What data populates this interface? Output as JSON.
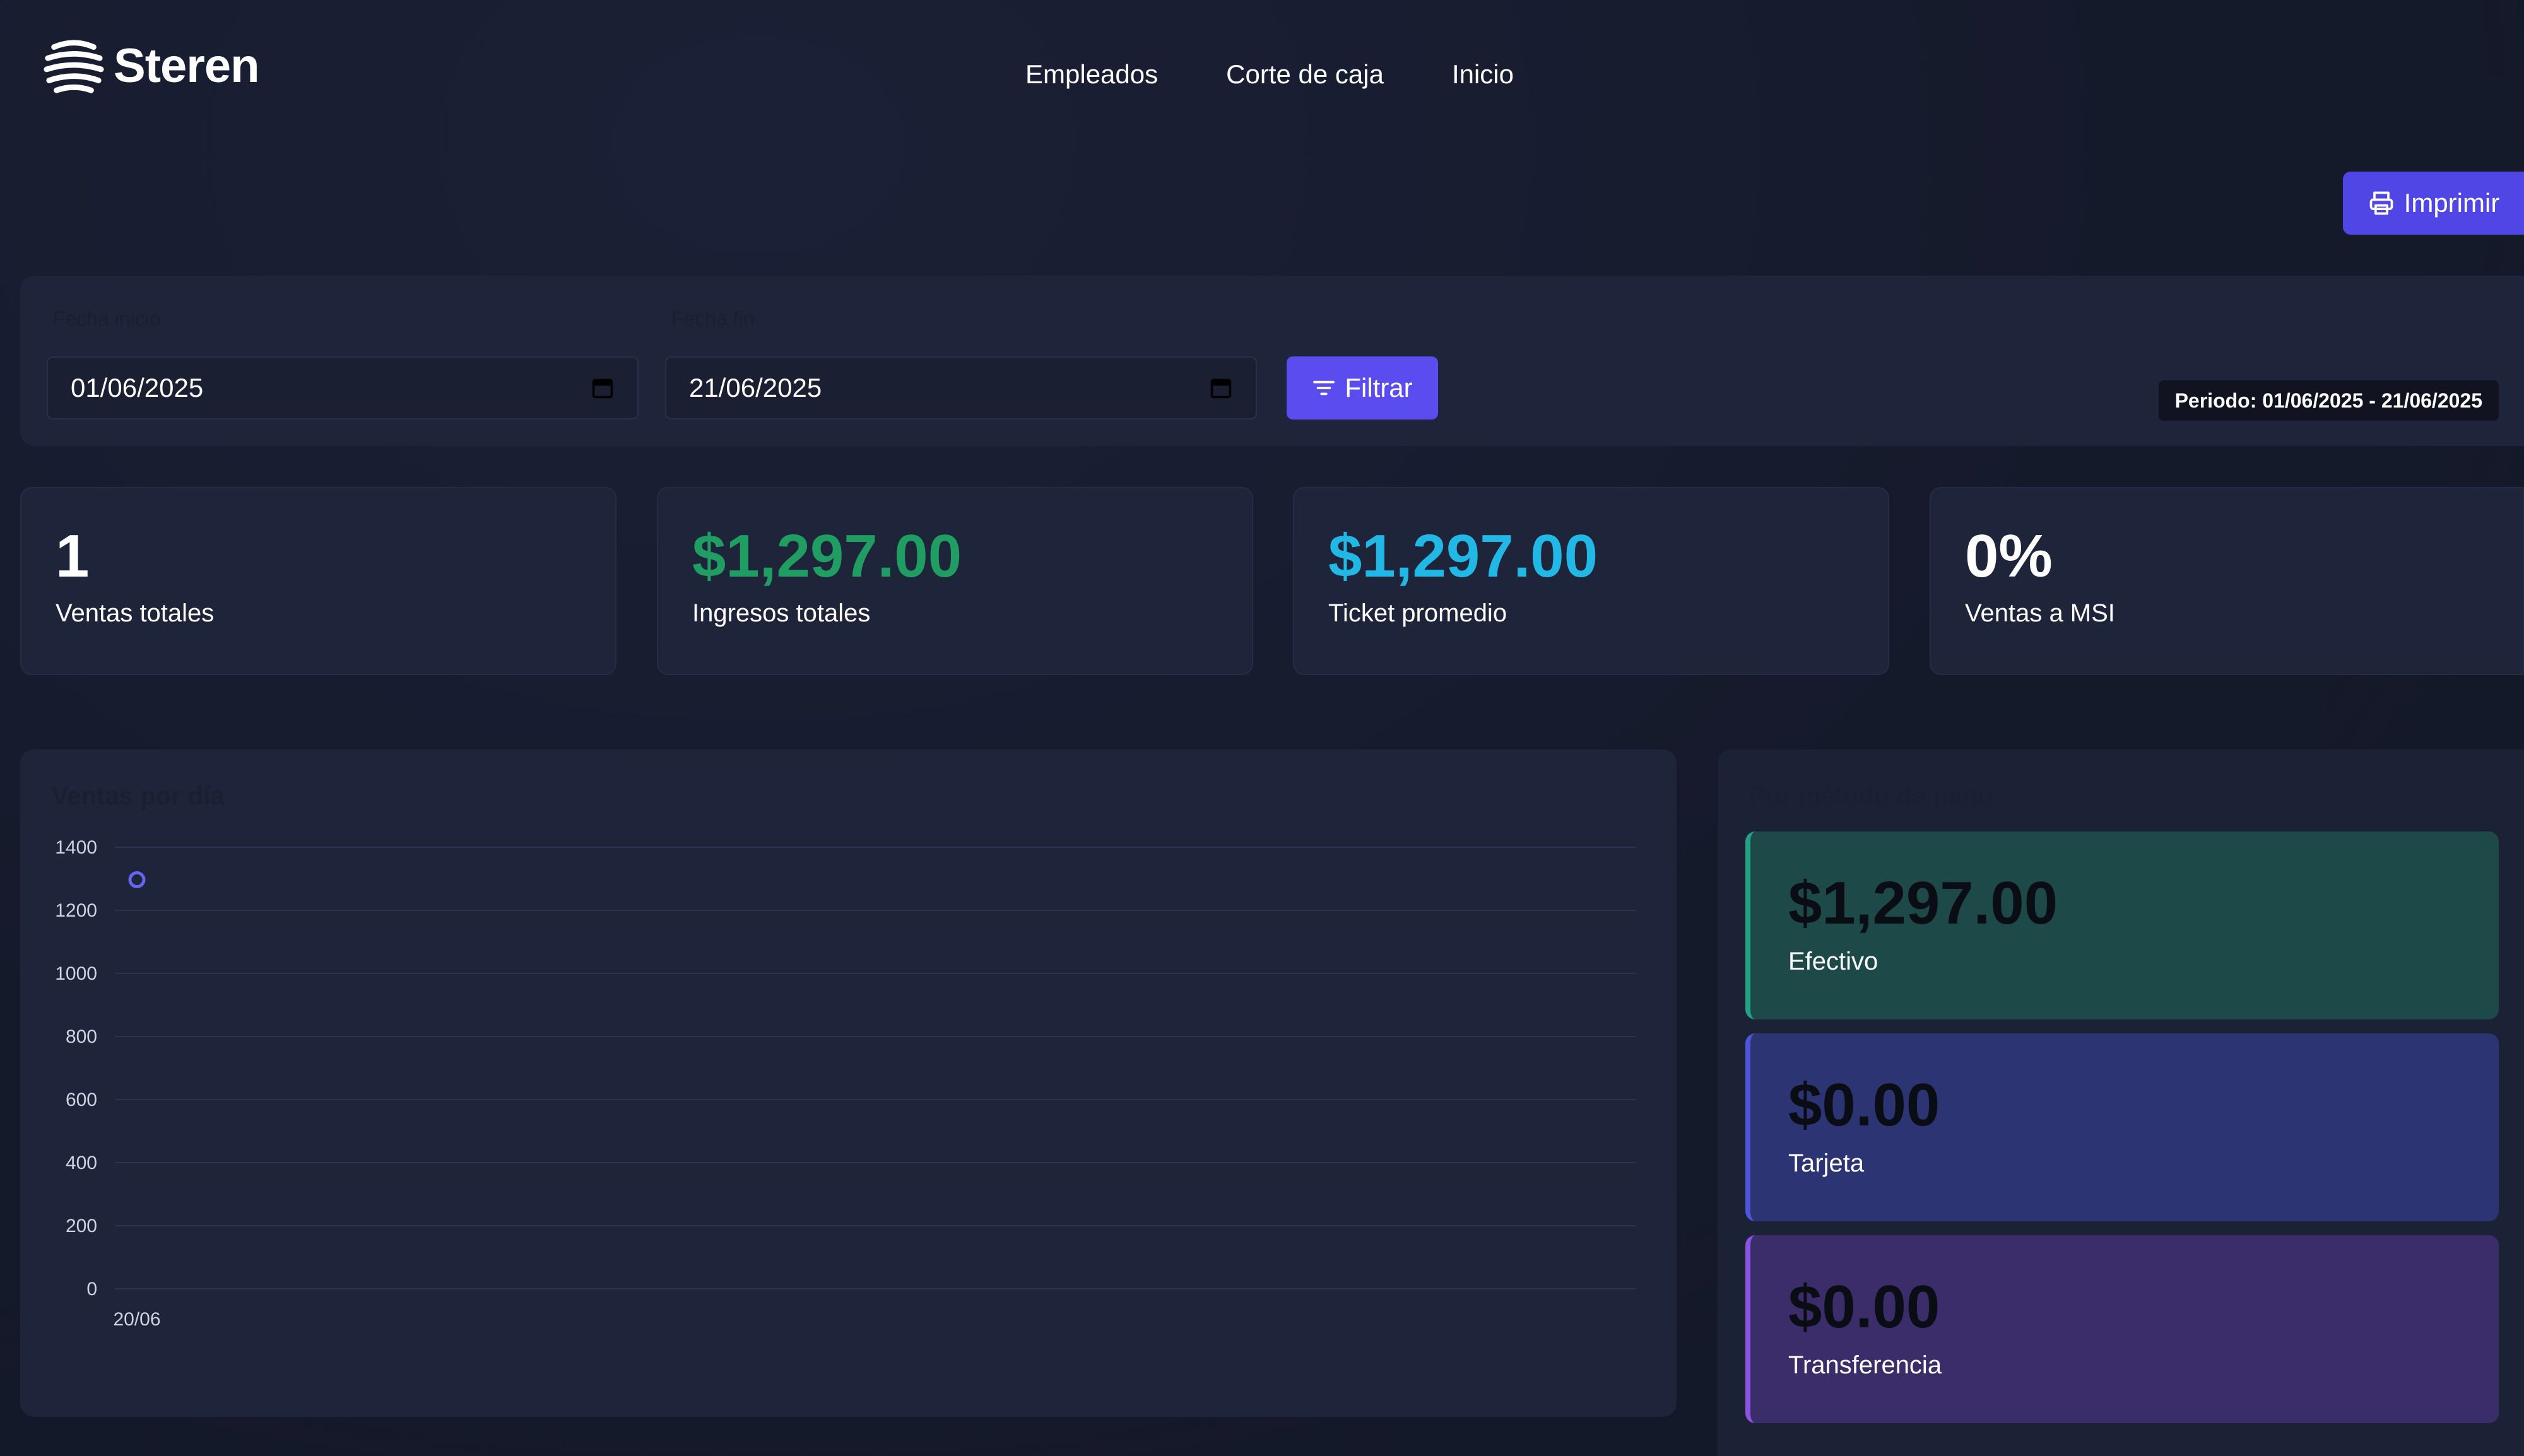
{
  "brand": {
    "name": "Steren"
  },
  "nav": {
    "items": [
      "Empleados",
      "Corte de caja",
      "Inicio"
    ]
  },
  "actions": {
    "print_label": "Imprimir"
  },
  "filters": {
    "start_label": "Fecha inicio",
    "end_label": "Fecha fin",
    "start_value": "01/06/2025",
    "end_value": "21/06/2025",
    "filter_label": "Filtrar",
    "period": "Periodo: 01/06/2025 - 21/06/2025"
  },
  "stats": [
    {
      "value": "1",
      "label": "Ventas totales",
      "color": "#ffffff"
    },
    {
      "value": "$1,297.00",
      "label": "Ingresos totales",
      "color": "#1f9d62"
    },
    {
      "value": "$1,297.00",
      "label": "Ticket promedio",
      "color": "#22b8e6"
    },
    {
      "value": "0%",
      "label": "Ventas a MSI",
      "color": "#ffffff"
    }
  ],
  "chart_panel": {
    "title": "Ventas por día"
  },
  "chart_data": {
    "type": "line",
    "title": "Ventas por día",
    "x": [
      "20/06"
    ],
    "series": [
      {
        "values": [
          1297
        ],
        "color": "#6366f1"
      }
    ],
    "ylim": [
      0,
      1400
    ],
    "yticks": [
      1400,
      1200,
      1000,
      800,
      600,
      400,
      200,
      0
    ],
    "grid": true
  },
  "payments_panel": {
    "title": "Por método de pago"
  },
  "payments": [
    {
      "value": "$1,297.00",
      "label": "Efectivo"
    },
    {
      "value": "$0.00",
      "label": "Tarjeta"
    },
    {
      "value": "$0.00",
      "label": "Transferencia"
    }
  ],
  "icons": {
    "logo": "steren-logo-icon",
    "print": "printer-icon",
    "calendar": "calendar-icon",
    "filter": "filter-icon"
  }
}
